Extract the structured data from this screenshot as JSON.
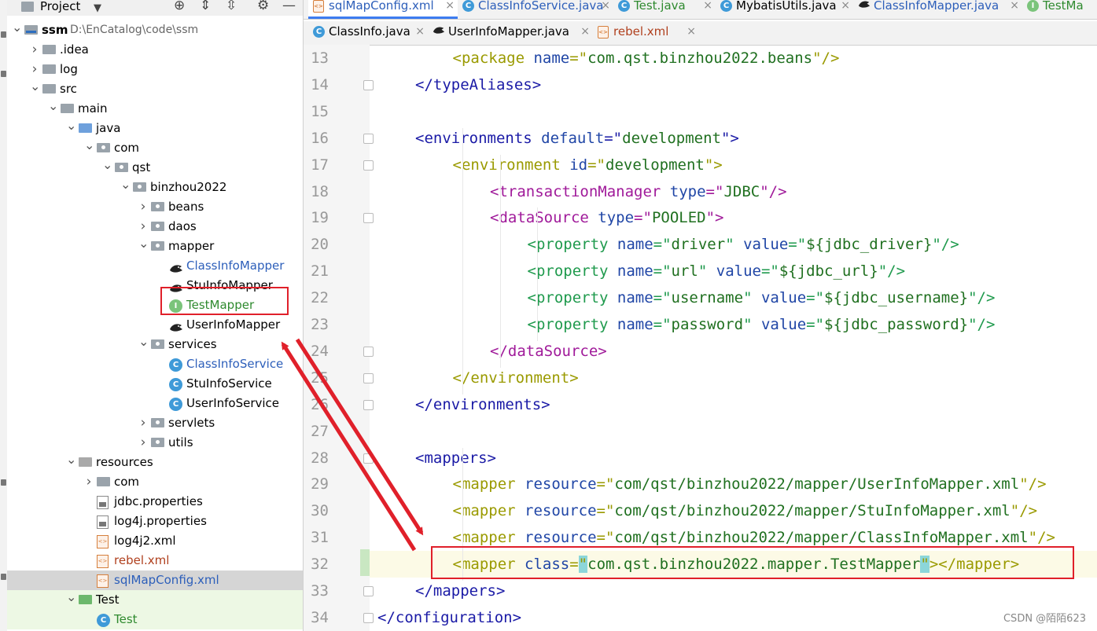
{
  "project_panel": {
    "title": "Project",
    "tree": [
      {
        "label": "ssm",
        "extra": "D:\\EnCatalog\\code\\ssm",
        "depth": 0,
        "icon": "project-folder",
        "expanded": true
      },
      {
        "label": ".idea",
        "depth": 1,
        "icon": "folder",
        "expanded": false
      },
      {
        "label": "log",
        "depth": 1,
        "icon": "folder",
        "expanded": false
      },
      {
        "label": "src",
        "depth": 1,
        "icon": "folder",
        "expanded": true
      },
      {
        "label": "main",
        "depth": 2,
        "icon": "folder",
        "expanded": true
      },
      {
        "label": "java",
        "depth": 3,
        "icon": "source-folder",
        "expanded": true
      },
      {
        "label": "com",
        "depth": 4,
        "icon": "package",
        "expanded": true
      },
      {
        "label": "qst",
        "depth": 5,
        "icon": "package",
        "expanded": true
      },
      {
        "label": "binzhou2022",
        "depth": 6,
        "icon": "package",
        "expanded": true
      },
      {
        "label": "beans",
        "depth": 7,
        "icon": "package",
        "expanded": false
      },
      {
        "label": "daos",
        "depth": 7,
        "icon": "package",
        "expanded": false
      },
      {
        "label": "mapper",
        "depth": 7,
        "icon": "package",
        "expanded": true
      },
      {
        "label": "ClassInfoMapper",
        "depth": 8,
        "icon": "mybatis",
        "color": "blue"
      },
      {
        "label": "StuInfoMapper",
        "depth": 8,
        "icon": "mybatis"
      },
      {
        "label": "TestMapper",
        "depth": 8,
        "icon": "interface",
        "color": "green"
      },
      {
        "label": "UserInfoMapper",
        "depth": 8,
        "icon": "mybatis"
      },
      {
        "label": "services",
        "depth": 7,
        "icon": "package",
        "expanded": true
      },
      {
        "label": "ClassInfoService",
        "depth": 8,
        "icon": "class",
        "color": "blue"
      },
      {
        "label": "StuInfoService",
        "depth": 8,
        "icon": "class"
      },
      {
        "label": "UserInfoService",
        "depth": 8,
        "icon": "class"
      },
      {
        "label": "servlets",
        "depth": 7,
        "icon": "package",
        "expanded": false
      },
      {
        "label": "utils",
        "depth": 7,
        "icon": "package",
        "expanded": false
      },
      {
        "label": "resources",
        "depth": 3,
        "icon": "resources-folder",
        "expanded": true
      },
      {
        "label": "com",
        "depth": 4,
        "icon": "folder",
        "expanded": false
      },
      {
        "label": "jdbc.properties",
        "depth": 4,
        "icon": "properties"
      },
      {
        "label": "log4j.properties",
        "depth": 4,
        "icon": "properties"
      },
      {
        "label": "log4j2.xml",
        "depth": 4,
        "icon": "xml"
      },
      {
        "label": "rebel.xml",
        "depth": 4,
        "icon": "xml",
        "color": "red"
      },
      {
        "label": "sqlMapConfig.xml",
        "depth": 4,
        "icon": "xml",
        "color": "blue",
        "selected": true
      },
      {
        "label": "Test",
        "depth": 3,
        "icon": "test-folder",
        "expanded": true,
        "group": true
      },
      {
        "label": "Test",
        "depth": 4,
        "icon": "class",
        "color": "green",
        "group": true
      }
    ]
  },
  "tabs_row1": [
    {
      "label": "sqlMapConfig.xml",
      "icon": "xml",
      "active": true,
      "color": "blue"
    },
    {
      "label": "ClassInfoService.java",
      "icon": "class",
      "color": "blue"
    },
    {
      "label": "Test.java",
      "icon": "class",
      "color": "green"
    },
    {
      "label": "MybatisUtils.java",
      "icon": "class"
    },
    {
      "label": "ClassInfoMapper.java",
      "icon": "mybatis",
      "color": "blue"
    },
    {
      "label": "TestMa",
      "icon": "interface",
      "color": "green"
    }
  ],
  "tabs_row2": [
    {
      "label": "ClassInfo.java",
      "icon": "class"
    },
    {
      "label": "UserInfoMapper.java",
      "icon": "mybatis"
    },
    {
      "label": "rebel.xml",
      "icon": "xml",
      "color": "red"
    }
  ],
  "code": {
    "lines": [
      {
        "n": "13",
        "indent": 2,
        "parts": [
          [
            "lvl2",
            "<package "
          ],
          [
            "at",
            "name"
          ],
          [
            "lvl2",
            "=\""
          ],
          [
            "val",
            "com.qst.binzhou2022.beans"
          ],
          [
            "lvl2",
            "\"/>"
          ]
        ]
      },
      {
        "n": "14",
        "indent": 1,
        "parts": [
          [
            "lvl1",
            "</typeAliases>"
          ]
        ]
      },
      {
        "n": "15",
        "indent": 0,
        "parts": []
      },
      {
        "n": "16",
        "indent": 1,
        "parts": [
          [
            "lvl1",
            "<environments "
          ],
          [
            "at",
            "default"
          ],
          [
            "lvl1",
            "=\""
          ],
          [
            "val",
            "development"
          ],
          [
            "lvl1",
            "\">"
          ]
        ]
      },
      {
        "n": "17",
        "indent": 2,
        "parts": [
          [
            "lvl2",
            "<environment "
          ],
          [
            "at",
            "id"
          ],
          [
            "lvl2",
            "=\""
          ],
          [
            "val",
            "development"
          ],
          [
            "lvl2",
            "\">"
          ]
        ]
      },
      {
        "n": "18",
        "indent": 3,
        "parts": [
          [
            "lvl3",
            "<transactionManager "
          ],
          [
            "at",
            "type"
          ],
          [
            "lvl3",
            "=\""
          ],
          [
            "val",
            "JDBC"
          ],
          [
            "lvl3",
            "\"/>"
          ]
        ]
      },
      {
        "n": "19",
        "indent": 3,
        "parts": [
          [
            "lvl3",
            "<dataSource "
          ],
          [
            "at",
            "type"
          ],
          [
            "lvl3",
            "=\""
          ],
          [
            "val",
            "POOLED"
          ],
          [
            "lvl3",
            "\">"
          ]
        ]
      },
      {
        "n": "20",
        "indent": 4,
        "parts": [
          [
            "lvl4",
            "<property "
          ],
          [
            "at",
            "name"
          ],
          [
            "lvl4",
            "=\""
          ],
          [
            "val",
            "driver"
          ],
          [
            "lvl4",
            "\" "
          ],
          [
            "at",
            "value"
          ],
          [
            "lvl4",
            "=\""
          ],
          [
            "val",
            "${jdbc_driver}"
          ],
          [
            "lvl4",
            "\"/>"
          ]
        ]
      },
      {
        "n": "21",
        "indent": 4,
        "parts": [
          [
            "lvl4",
            "<property "
          ],
          [
            "at",
            "name"
          ],
          [
            "lvl4",
            "=\""
          ],
          [
            "val",
            "url"
          ],
          [
            "lvl4",
            "\" "
          ],
          [
            "at",
            "value"
          ],
          [
            "lvl4",
            "=\""
          ],
          [
            "val",
            "${jdbc_url}"
          ],
          [
            "lvl4",
            "\"/>"
          ]
        ]
      },
      {
        "n": "22",
        "indent": 4,
        "parts": [
          [
            "lvl4",
            "<property "
          ],
          [
            "at",
            "name"
          ],
          [
            "lvl4",
            "=\""
          ],
          [
            "val",
            "username"
          ],
          [
            "lvl4",
            "\" "
          ],
          [
            "at",
            "value"
          ],
          [
            "lvl4",
            "=\""
          ],
          [
            "val",
            "${jdbc_username}"
          ],
          [
            "lvl4",
            "\"/>"
          ]
        ]
      },
      {
        "n": "23",
        "indent": 4,
        "parts": [
          [
            "lvl4",
            "<property "
          ],
          [
            "at",
            "name"
          ],
          [
            "lvl4",
            "=\""
          ],
          [
            "val",
            "password"
          ],
          [
            "lvl4",
            "\" "
          ],
          [
            "at",
            "value"
          ],
          [
            "lvl4",
            "=\""
          ],
          [
            "val",
            "${jdbc_password}"
          ],
          [
            "lvl4",
            "\"/>"
          ]
        ]
      },
      {
        "n": "24",
        "indent": 3,
        "parts": [
          [
            "lvl3",
            "</dataSource>"
          ]
        ]
      },
      {
        "n": "25",
        "indent": 2,
        "parts": [
          [
            "lvl2",
            "</environment>"
          ]
        ]
      },
      {
        "n": "26",
        "indent": 1,
        "parts": [
          [
            "lvl1",
            "</environments>"
          ]
        ]
      },
      {
        "n": "27",
        "indent": 0,
        "parts": []
      },
      {
        "n": "28",
        "indent": 1,
        "parts": [
          [
            "lvl1",
            "<mappers>"
          ]
        ]
      },
      {
        "n": "29",
        "indent": 2,
        "parts": [
          [
            "lvl2",
            "<mapper "
          ],
          [
            "at",
            "resource"
          ],
          [
            "lvl2",
            "=\""
          ],
          [
            "val",
            "com/qst/binzhou2022/mapper/UserInfoMapper.xml"
          ],
          [
            "lvl2",
            "\"/>"
          ]
        ]
      },
      {
        "n": "30",
        "indent": 2,
        "parts": [
          [
            "lvl2",
            "<mapper "
          ],
          [
            "at",
            "resource"
          ],
          [
            "lvl2",
            "=\""
          ],
          [
            "val",
            "com/qst/binzhou2022/mapper/StuInfoMapper.xml"
          ],
          [
            "lvl2",
            "\"/>"
          ]
        ]
      },
      {
        "n": "31",
        "indent": 2,
        "parts": [
          [
            "lvl2",
            "<mapper "
          ],
          [
            "at",
            "resource"
          ],
          [
            "lvl2",
            "=\""
          ],
          [
            "val",
            "com/qst/binzhou2022/mapper/ClassInfoMapper.xml"
          ],
          [
            "lvl2",
            "\"/>"
          ]
        ]
      },
      {
        "n": "32",
        "indent": 2,
        "current": true,
        "parts": [
          [
            "lvl2",
            "<mapper "
          ],
          [
            "at",
            "class"
          ],
          [
            "lvl2",
            "="
          ],
          [
            "hlq",
            "\""
          ],
          [
            "val",
            "com.qst.binzhou2022.mapper.TestMapper"
          ],
          [
            "hlq",
            "\""
          ],
          [
            "lvl2",
            "></mapper>"
          ]
        ]
      },
      {
        "n": "33",
        "indent": 1,
        "parts": [
          [
            "lvl1",
            "</mappers>"
          ]
        ]
      },
      {
        "n": "34",
        "indent": 0,
        "parts": [
          [
            "lvl1",
            "</configuration>"
          ]
        ]
      }
    ]
  },
  "watermark": "CSDN @陌陌623",
  "colors": {
    "annotation_red": "#e0202a",
    "active_tab": "#3d7cf0"
  }
}
